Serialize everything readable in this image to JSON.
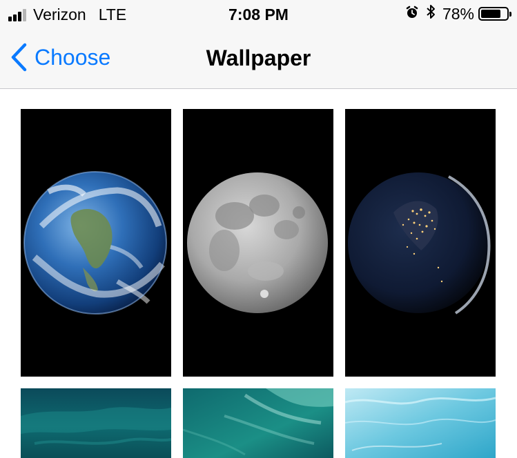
{
  "status_bar": {
    "carrier": "Verizon",
    "network": "LTE",
    "time": "7:08 PM",
    "battery_percent": "78%",
    "battery_level": 0.78,
    "signal_bars": 3,
    "icons": [
      "alarm-icon",
      "bluetooth-icon"
    ]
  },
  "nav": {
    "back_label": "Choose",
    "title": "Wallpaper"
  },
  "wallpapers": [
    {
      "name": "earth",
      "row": 1
    },
    {
      "name": "moon",
      "row": 1
    },
    {
      "name": "earth-night",
      "row": 1
    },
    {
      "name": "ocean-aerial-dark",
      "row": 2
    },
    {
      "name": "ocean-aerial-waves",
      "row": 2
    },
    {
      "name": "ocean-aerial-light",
      "row": 2
    }
  ],
  "colors": {
    "accent": "#0a7aff",
    "bar_background": "#f7f7f7",
    "separator": "#c8c7cc"
  }
}
